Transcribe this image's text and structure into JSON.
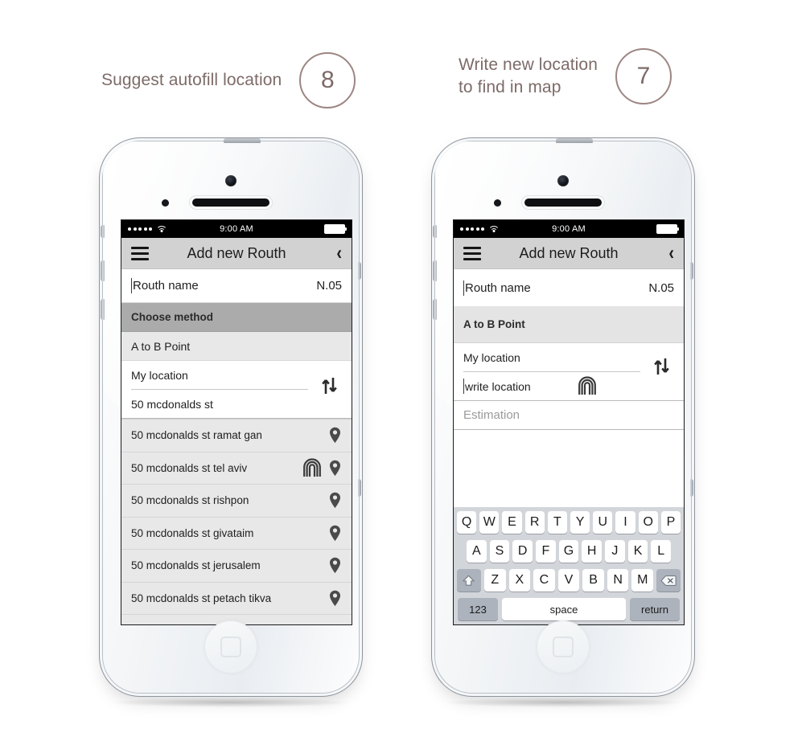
{
  "annotations": [
    {
      "text": "Suggest autofill location",
      "number": "8"
    },
    {
      "text": "Write new location\nto find in map",
      "number": "7"
    }
  ],
  "status_bar": {
    "time": "9:00 AM",
    "signal_dots": 5,
    "wifi_icon": "wifi-icon",
    "battery_icon": "battery-full-icon"
  },
  "nav": {
    "menu_icon": "hamburger-menu-icon",
    "title": "Add new Routh",
    "back_icon": "chevron-left-icon"
  },
  "route_name": {
    "placeholder": "Routh name",
    "value": "N.05"
  },
  "left_phone": {
    "section_header": "Choose method",
    "method_option": "A to B Point",
    "origin": "My location",
    "destination": "50 mcdonalds st",
    "swap_icon": "swap-vertical-arrows-icon",
    "suggestions": [
      {
        "label": "50 mcdonalds st ramat gan",
        "pin_icon": "map-pin-icon",
        "tap_icon": null
      },
      {
        "label": "50 mcdonalds st tel aviv",
        "pin_icon": "map-pin-icon",
        "tap_icon": "fingerprint-tap-icon"
      },
      {
        "label": "50 mcdonalds st rishpon",
        "pin_icon": "map-pin-icon",
        "tap_icon": null
      },
      {
        "label": "50 mcdonalds st givataim",
        "pin_icon": "map-pin-icon",
        "tap_icon": null
      },
      {
        "label": "50 mcdonalds st jerusalem",
        "pin_icon": "map-pin-icon",
        "tap_icon": null
      },
      {
        "label": "50 mcdonalds st petach tikva",
        "pin_icon": "map-pin-icon",
        "tap_icon": null
      }
    ]
  },
  "right_phone": {
    "section_header": "A to B Point",
    "origin": "My location",
    "destination_placeholder": "write location",
    "tap_icon": "fingerprint-tap-icon",
    "estimation_placeholder": "Estimation",
    "swap_icon": "swap-vertical-arrows-icon",
    "keyboard": {
      "row1": [
        "Q",
        "W",
        "E",
        "R",
        "T",
        "Y",
        "U",
        "I",
        "O",
        "P"
      ],
      "row2": [
        "A",
        "S",
        "D",
        "F",
        "G",
        "H",
        "J",
        "K",
        "L"
      ],
      "row3": [
        "Z",
        "X",
        "C",
        "V",
        "B",
        "N",
        "M"
      ],
      "shift_icon": "shift-up-arrow-icon",
      "backspace_icon": "backspace-delete-icon",
      "numbers_key": "123",
      "space_key": "space",
      "return_key": "return"
    }
  },
  "colors": {
    "annotation": "#7d6b68",
    "nav_bar": "#d2d2d2",
    "section_dark": "#ababab",
    "section_light": "#e4e4e4",
    "list_bg": "#e8e8e8",
    "keyboard_bg": "#d2d5da",
    "key_fn": "#adb3bd"
  }
}
